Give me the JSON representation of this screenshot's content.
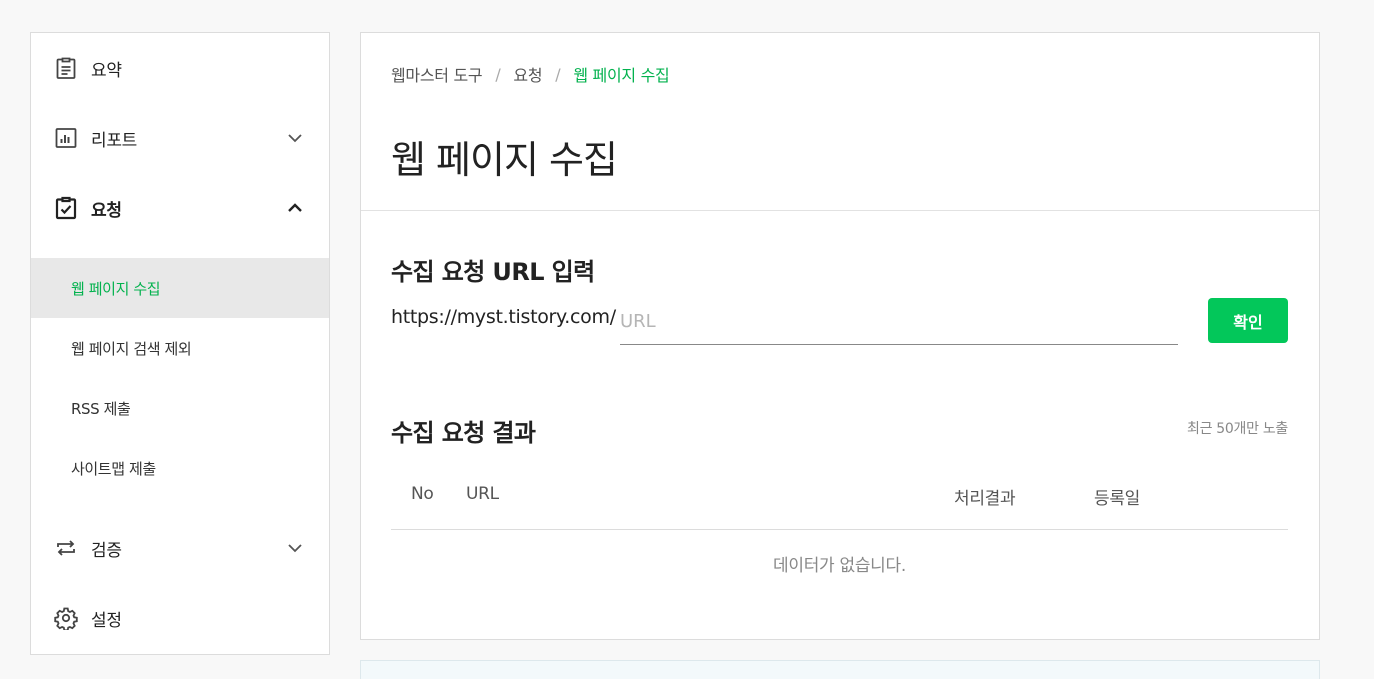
{
  "sidebar": {
    "items": [
      {
        "label": "요약",
        "icon": "clipboard-list-icon"
      },
      {
        "label": "리포트",
        "icon": "bar-chart-icon",
        "expanded": false
      },
      {
        "label": "요청",
        "icon": "clipboard-check-icon",
        "expanded": true,
        "children": [
          {
            "label": "웹 페이지 수집",
            "selected": true
          },
          {
            "label": "웹 페이지 검색 제외"
          },
          {
            "label": "RSS 제출"
          },
          {
            "label": "사이트맵 제출"
          }
        ]
      },
      {
        "label": "검증",
        "icon": "repeat-arrows-icon",
        "expanded": false
      },
      {
        "label": "설정",
        "icon": "gear-icon"
      }
    ]
  },
  "breadcrumb": [
    "웹마스터 도구",
    "요청",
    "웹 페이지 수집"
  ],
  "breadcrumb_separator": "/",
  "page_title": "웹 페이지 수집",
  "request_form": {
    "title": "수집 요청 URL 입력",
    "url_prefix": "https://myst.tistory.com/",
    "placeholder": "URL",
    "value": "",
    "button_label": "확인"
  },
  "results": {
    "title": "수집 요청 결과",
    "note": "최근 50개만 노출",
    "columns": [
      "No",
      "URL",
      "처리결과",
      "등록일"
    ],
    "rows": [],
    "empty_message": "데이터가 없습니다."
  },
  "colors": {
    "accent": "#03c75a",
    "accent_text": "#03b24e",
    "selected_bg": "#e8e8e8"
  }
}
